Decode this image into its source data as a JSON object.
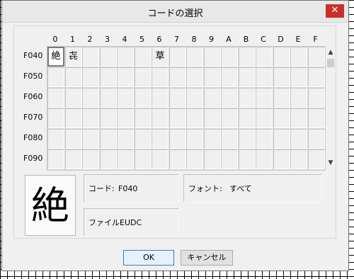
{
  "dialog": {
    "title": "コードの選択",
    "close_label": "✕"
  },
  "columns": [
    "0",
    "1",
    "2",
    "3",
    "4",
    "5",
    "6",
    "7",
    "8",
    "9",
    "A",
    "B",
    "C",
    "D",
    "E",
    "F"
  ],
  "rows": [
    "F040",
    "F050",
    "F060",
    "F070",
    "F080",
    "F090"
  ],
  "cells": {
    "F040": {
      "0": "絶",
      "1": "㐂",
      "6": "草"
    }
  },
  "selected": {
    "row": "F040",
    "col": "0"
  },
  "preview_char": "絶",
  "info": {
    "code_label": "コード:",
    "code_value": "F040",
    "font_label": "フォント:",
    "font_value": "すべて",
    "file_label": "ファイル:",
    "file_value": "EUDC"
  },
  "scrollbar": {
    "up": "▲",
    "down": "▼"
  },
  "buttons": {
    "ok": "OK",
    "cancel": "キャンセル"
  }
}
